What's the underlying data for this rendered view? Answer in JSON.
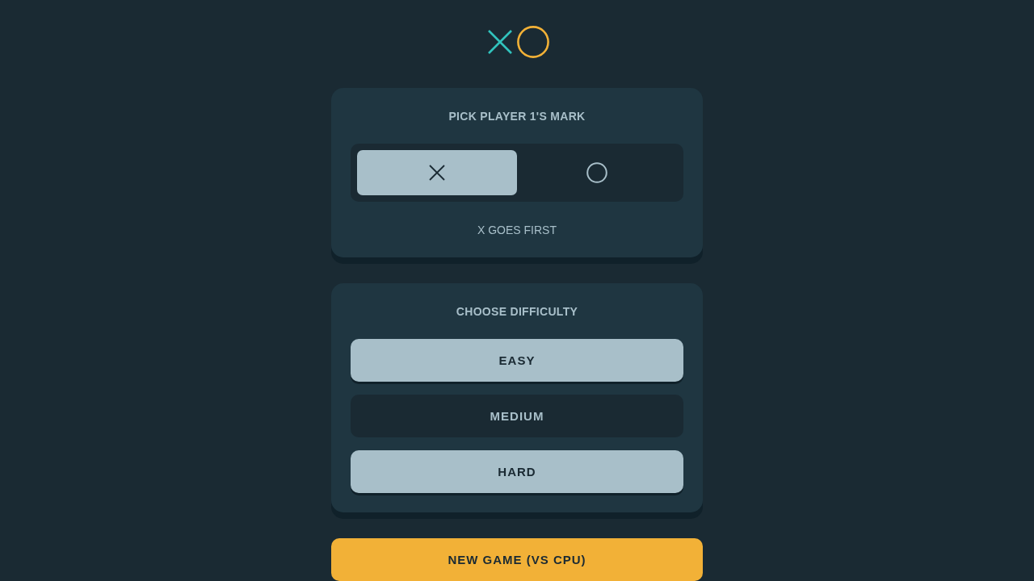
{
  "mark_picker": {
    "title": "PICK PLAYER 1'S MARK",
    "options": [
      {
        "kind": "x",
        "selected": true
      },
      {
        "kind": "o",
        "selected": false
      }
    ],
    "note": "X GOES FIRST"
  },
  "difficulty": {
    "title": "CHOOSE DIFFICULTY",
    "options": [
      {
        "label": "EASY",
        "selected": false
      },
      {
        "label": "MEDIUM",
        "selected": true
      },
      {
        "label": "HARD",
        "selected": false
      }
    ]
  },
  "new_game_button": {
    "label": "NEW GAME (VS CPU)"
  }
}
